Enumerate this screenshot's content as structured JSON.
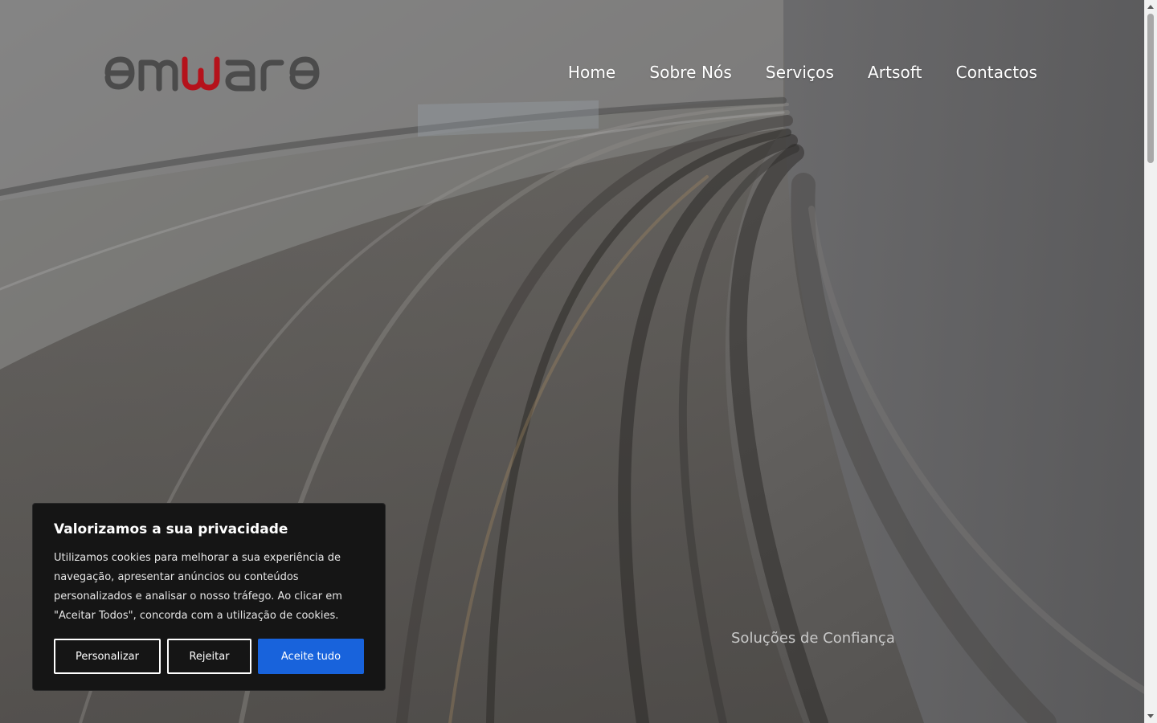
{
  "brand": {
    "logo_text": "emware",
    "colors": {
      "logo_gray": "#4b4b4b",
      "logo_red": "#b5121b",
      "accent_blue": "#1863dc"
    }
  },
  "nav": {
    "items": [
      {
        "label": "Home"
      },
      {
        "label": "Sobre Nós"
      },
      {
        "label": "Serviços"
      },
      {
        "label": "Artsoft"
      },
      {
        "label": "Contactos"
      }
    ]
  },
  "hero": {
    "tagline": "Soluções de Confiança"
  },
  "cookie_banner": {
    "title": "Valorizamos a sua privacidade",
    "text": "Utilizamos cookies para melhorar a sua experiência de navegação, apresentar anúncios ou conteúdos personalizados e analisar o nosso tráfego. Ao clicar em \"Aceitar Todos\", concorda com a utilização de cookies.",
    "buttons": {
      "customize": "Personalizar",
      "reject": "Rejeitar",
      "accept": "Aceite tudo"
    }
  }
}
